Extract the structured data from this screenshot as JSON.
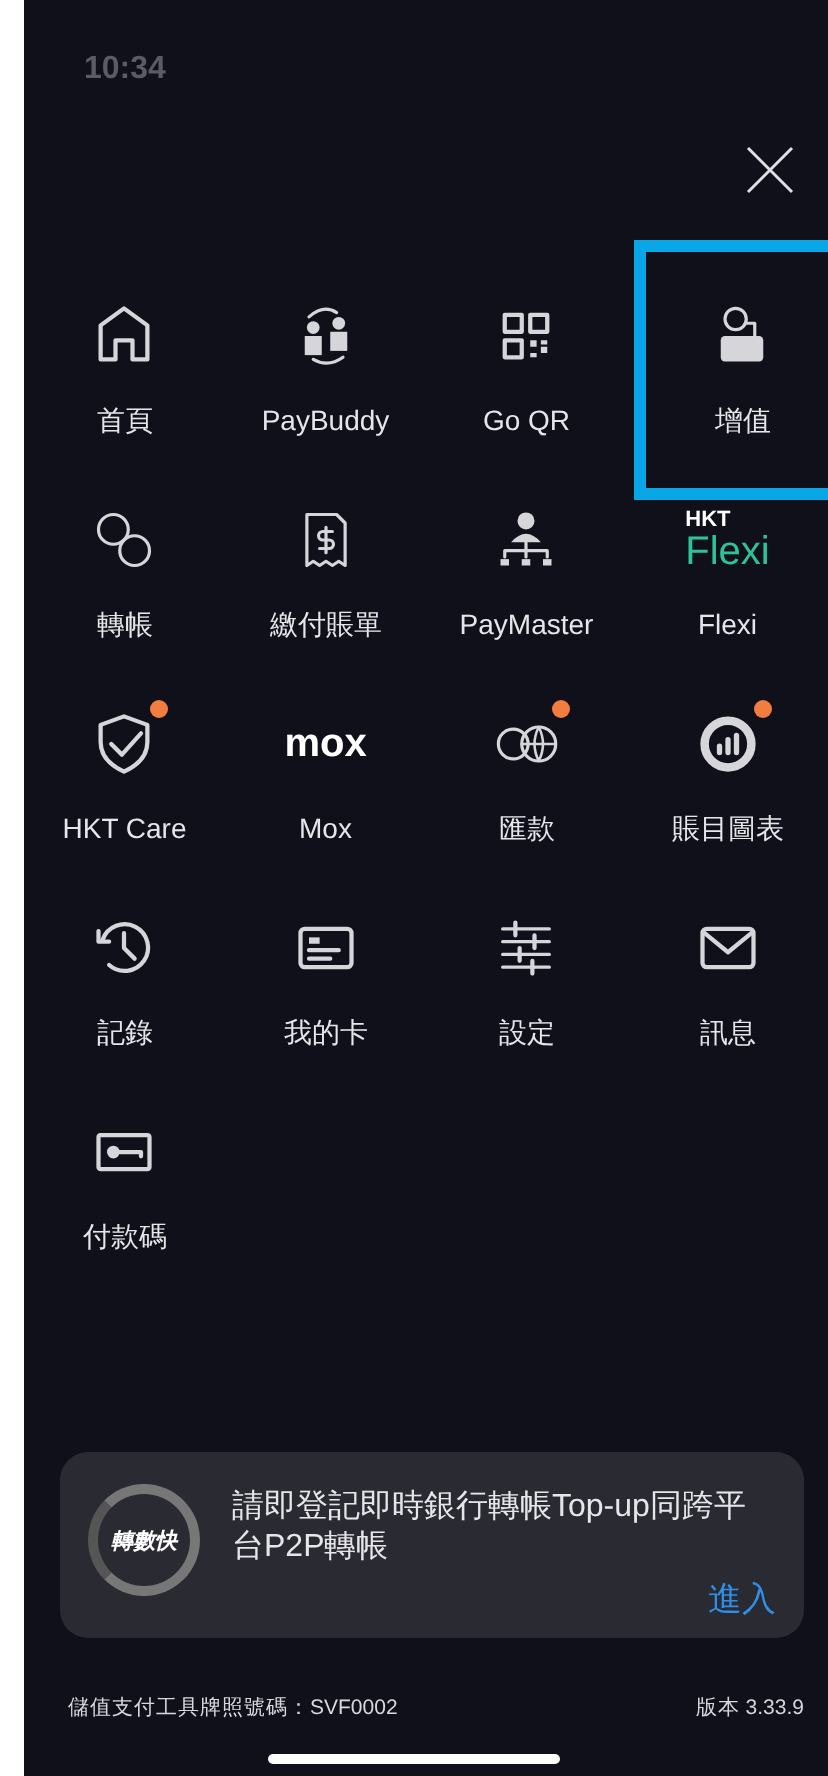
{
  "status_bar": {
    "time": "10:34"
  },
  "menu_items": [
    {
      "kind": "icon",
      "label": "首頁",
      "badge": false,
      "highlighted": false
    },
    {
      "kind": "icon",
      "label": "PayBuddy",
      "badge": false,
      "highlighted": false
    },
    {
      "kind": "icon",
      "label": "Go QR",
      "badge": false,
      "highlighted": false
    },
    {
      "kind": "icon",
      "label": "增值",
      "badge": false,
      "highlighted": true
    },
    {
      "kind": "icon",
      "label": "轉帳",
      "badge": false,
      "highlighted": false
    },
    {
      "kind": "icon",
      "label": "繳付賬單",
      "badge": false,
      "highlighted": false
    },
    {
      "kind": "icon",
      "label": "PayMaster",
      "badge": false,
      "highlighted": false
    },
    {
      "kind": "logo",
      "logo_top": "HKT",
      "logo_main": "Flexi",
      "label": "Flexi",
      "badge": false,
      "highlighted": false
    },
    {
      "kind": "icon",
      "label": "HKT Care",
      "badge": true,
      "highlighted": false
    },
    {
      "kind": "logo",
      "logo_main": "mox",
      "label": "Mox",
      "badge": false,
      "highlighted": false
    },
    {
      "kind": "icon",
      "label": "匯款",
      "badge": true,
      "highlighted": false
    },
    {
      "kind": "icon",
      "label": "賬目圖表",
      "badge": true,
      "highlighted": false
    },
    {
      "kind": "icon",
      "label": "記錄",
      "badge": false,
      "highlighted": false
    },
    {
      "kind": "icon",
      "label": "我的卡",
      "badge": false,
      "highlighted": false
    },
    {
      "kind": "icon",
      "label": "設定",
      "badge": false,
      "highlighted": false
    },
    {
      "kind": "icon",
      "label": "訊息",
      "badge": false,
      "highlighted": false
    },
    {
      "kind": "icon",
      "label": "付款碼",
      "badge": false,
      "highlighted": false
    }
  ],
  "banner": {
    "logo_text": "轉數快",
    "message": "請即登記即時銀行轉帳Top-up同跨平台P2P轉帳",
    "action": "進入"
  },
  "footer": {
    "license": "儲值支付工具牌照號碼：SVF0002",
    "version": "版本 3.33.9"
  }
}
